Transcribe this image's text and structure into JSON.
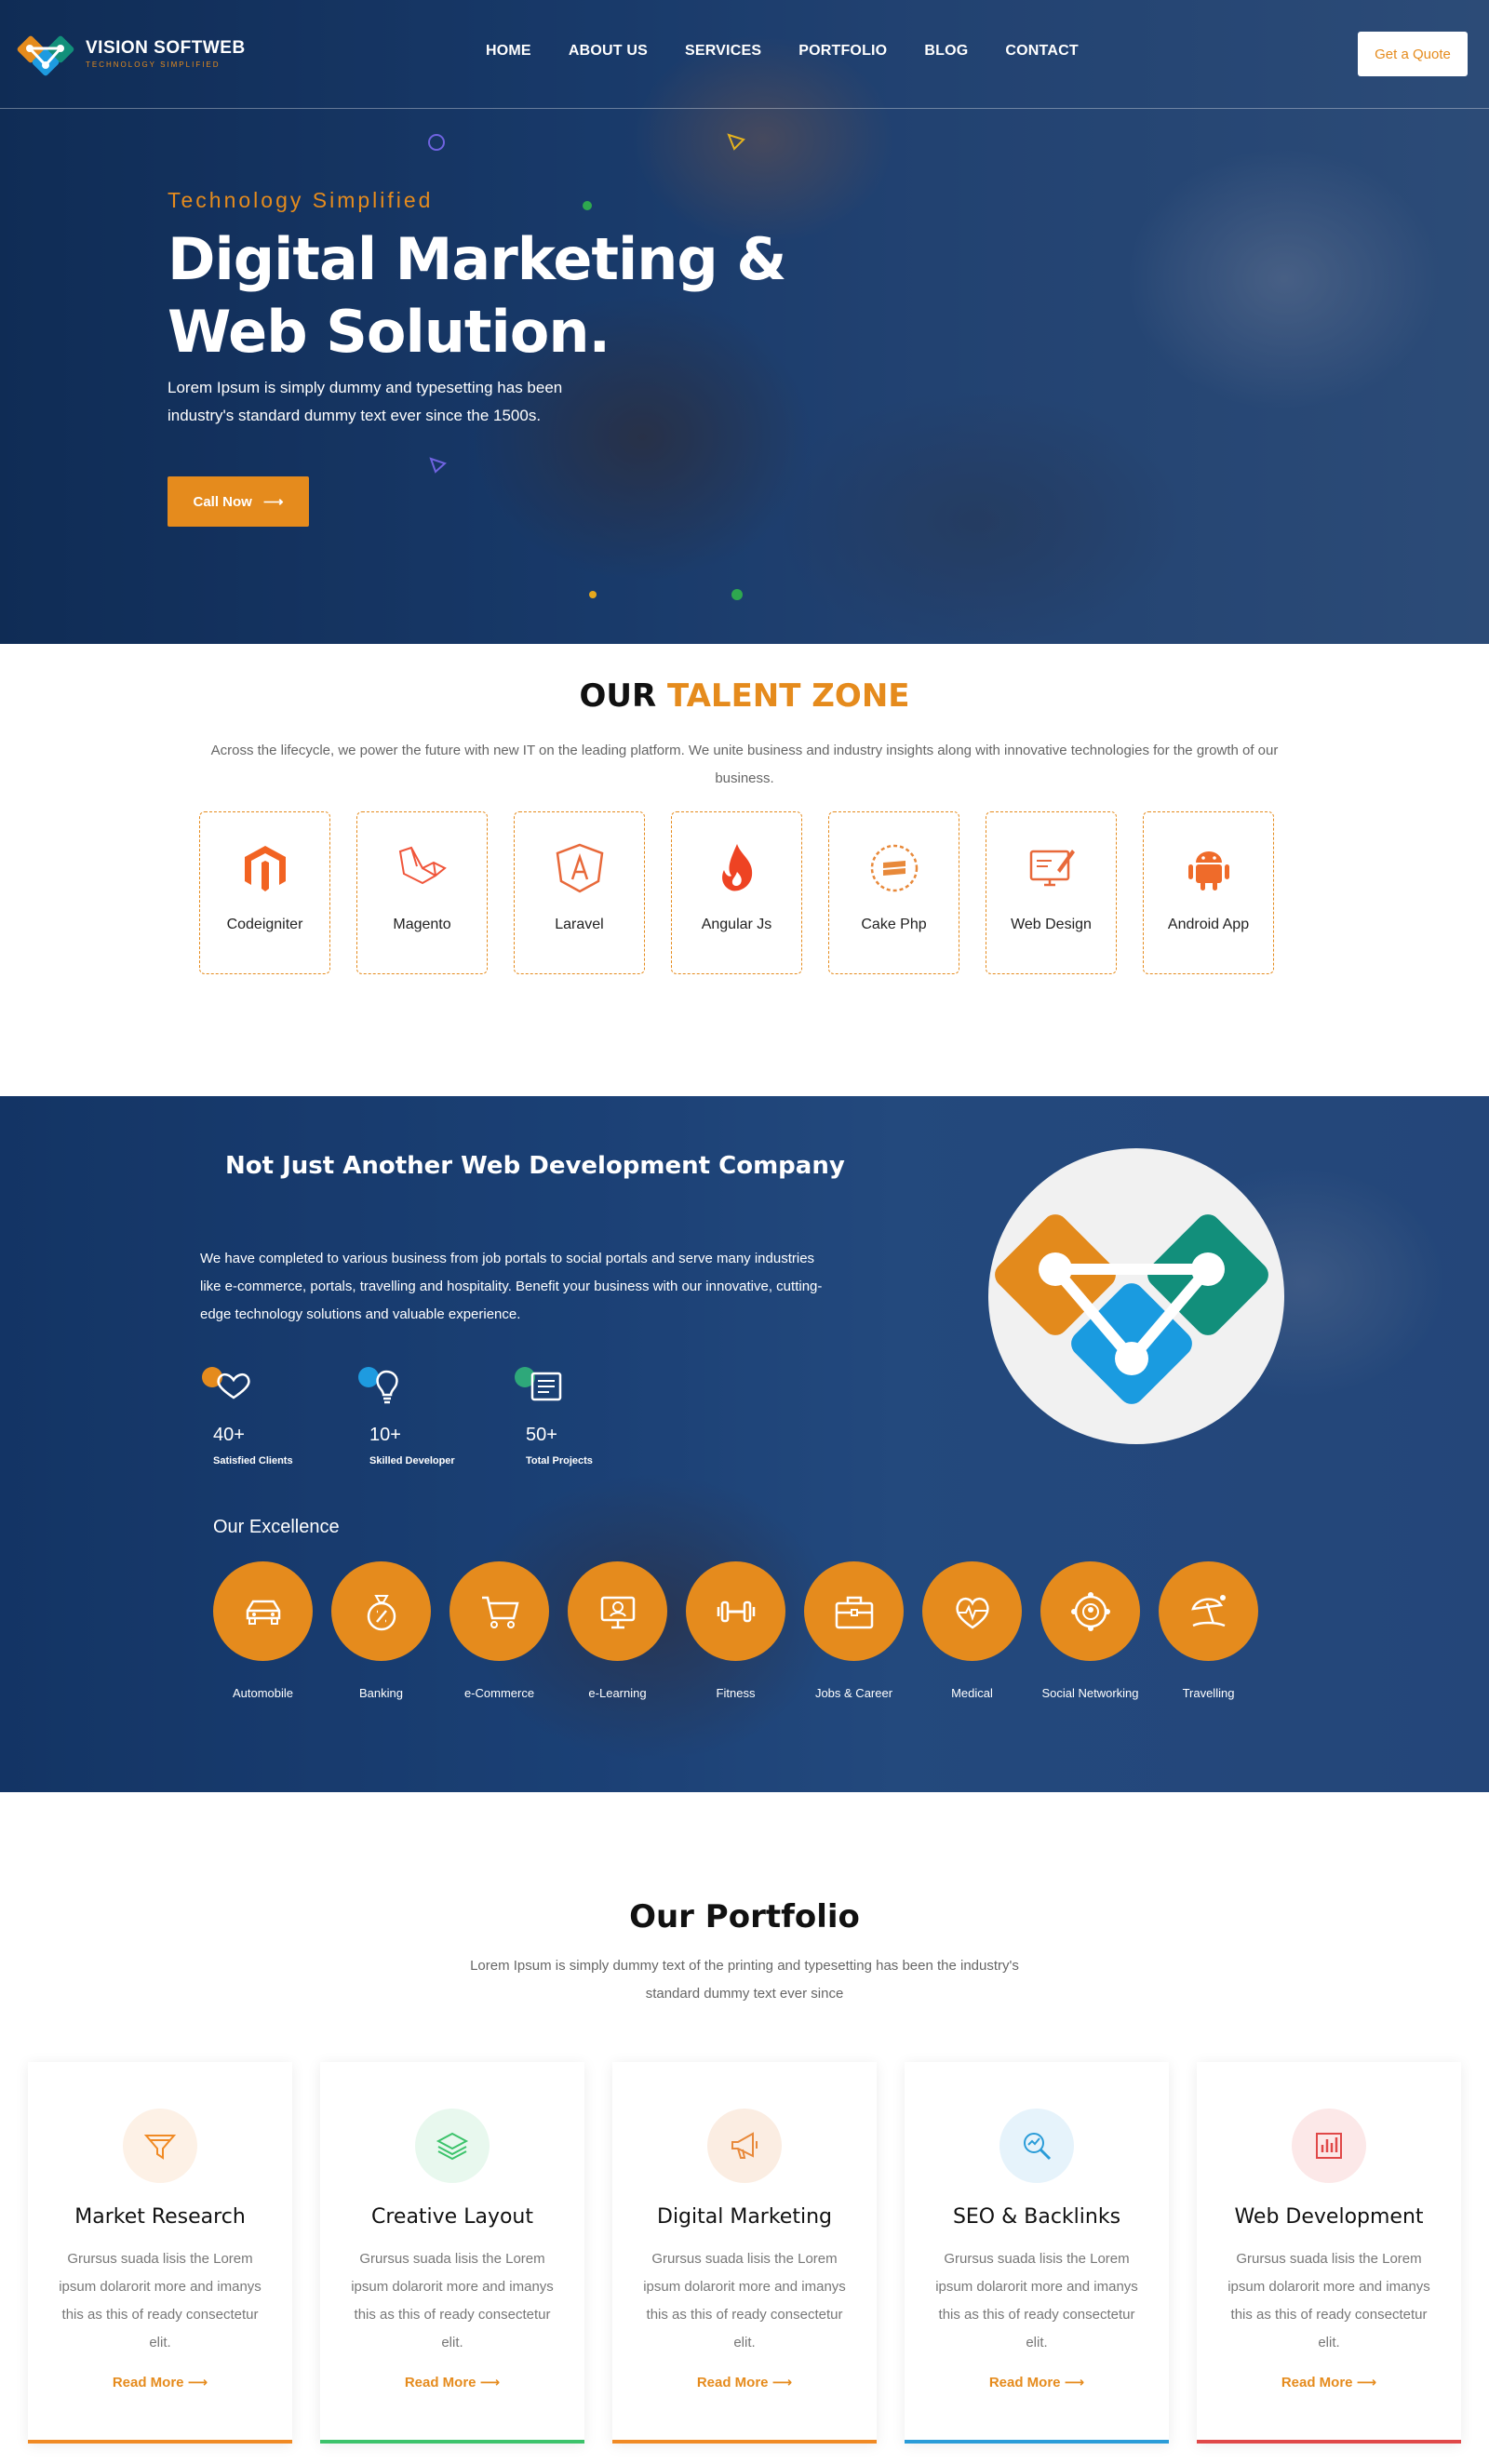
{
  "brand": {
    "name": "VISION SOFTWEB",
    "tagline": "TECHNOLOGY SIMPLIFIED"
  },
  "nav": {
    "items": [
      "HOME",
      "ABOUT US",
      "SERVICES",
      "PORTFOLIO",
      "BLOG",
      "CONTACT"
    ],
    "quote_label": "Get a Quote"
  },
  "hero": {
    "tag": "Technology Simplified",
    "title_line1": "Digital Marketing &",
    "title_line2": "Web Solution.",
    "text": "Lorem Ipsum is simply dummy and typesetting has been industry's standard dummy text ever since the 1500s.",
    "cta_label": "Call Now",
    "cta_arrow": "⟶"
  },
  "talent": {
    "title_plain": "OUR",
    "title_highlight": "TALENT ZONE",
    "description": "Across the lifecycle, we power the future with new IT on the leading platform. We unite business and industry insights along with innovative technologies for the growth of our business.",
    "items": [
      {
        "label": "Codeigniter",
        "icon": "magento-icon"
      },
      {
        "label": "Magento",
        "icon": "laravel-icon"
      },
      {
        "label": "Laravel",
        "icon": "angular-icon"
      },
      {
        "label": "Angular Js",
        "icon": "codeigniter-flame-icon"
      },
      {
        "label": "Cake Php",
        "icon": "cakephp-icon"
      },
      {
        "label": "Web Design",
        "icon": "web-design-icon"
      },
      {
        "label": "Android App",
        "icon": "android-icon"
      }
    ]
  },
  "company": {
    "title": "Not Just Another Web Development Company",
    "text": "We have completed to various business from job portals to social portals and serve many industries like e-commerce, portals, travelling and hospitality. Benefit your business with our innovative, cutting-edge technology solutions and valuable experience.",
    "stats": [
      {
        "value": "40+",
        "label": "Satisfied Clients",
        "icon": "heart-icon"
      },
      {
        "value": "10+",
        "label": "Skilled Developer",
        "icon": "bulb-icon"
      },
      {
        "value": "50+",
        "label": "Total Projects",
        "icon": "document-icon"
      }
    ],
    "excellence_title": "Our Excellence",
    "excellence": [
      {
        "label": "Automobile",
        "icon": "car-icon"
      },
      {
        "label": "Banking",
        "icon": "money-bag-icon"
      },
      {
        "label": "e-Commerce",
        "icon": "cart-icon"
      },
      {
        "label": "e-Learning",
        "icon": "monitor-learning-icon"
      },
      {
        "label": "Fitness",
        "icon": "dumbbell-icon"
      },
      {
        "label": "Jobs & Career",
        "icon": "briefcase-icon"
      },
      {
        "label": "Medical",
        "icon": "heartbeat-icon"
      },
      {
        "label": "Social Networking",
        "icon": "social-network-icon"
      },
      {
        "label": "Travelling",
        "icon": "beach-umbrella-icon"
      }
    ]
  },
  "portfolio": {
    "title": "Our Portfolio",
    "description": "Lorem Ipsum is simply dummy text of the printing and typesetting has been the industry's standard dummy text ever since",
    "cards": [
      {
        "title": "Market Research",
        "text": "Grursus suada lisis the Lorem ipsum dolarorit more and imanys this as this of ready consectetur elit.",
        "more": "Read More",
        "icon": "funnel-icon",
        "color": "#f08a24",
        "bg": "#fdf1e6"
      },
      {
        "title": "Creative Layout",
        "text": "Grursus suada lisis the Lorem ipsum dolarorit more and imanys this as this of ready consectetur elit.",
        "more": "Read More",
        "icon": "layers-icon",
        "color": "#3cc36b",
        "bg": "#e8f8ee"
      },
      {
        "title": "Digital Marketing",
        "text": "Grursus suada lisis the Lorem ipsum dolarorit more and imanys this as this of ready consectetur elit.",
        "more": "Read More",
        "icon": "megaphone-icon",
        "color": "#e8893a",
        "bg": "#fbede2"
      },
      {
        "title": "SEO & Backlinks",
        "text": "Grursus suada lisis the Lorem ipsum dolarorit more and imanys this as this of ready consectetur elit.",
        "more": "Read More",
        "icon": "seo-search-icon",
        "color": "#2a9cd8",
        "bg": "#e6f3fb"
      },
      {
        "title": "Web Development",
        "text": "Grursus suada lisis the Lorem ipsum dolarorit more and imanys this as this of ready consectetur elit.",
        "more": "Read More",
        "icon": "bar-chart-icon",
        "color": "#e04848",
        "bg": "#fce8e8"
      }
    ]
  }
}
